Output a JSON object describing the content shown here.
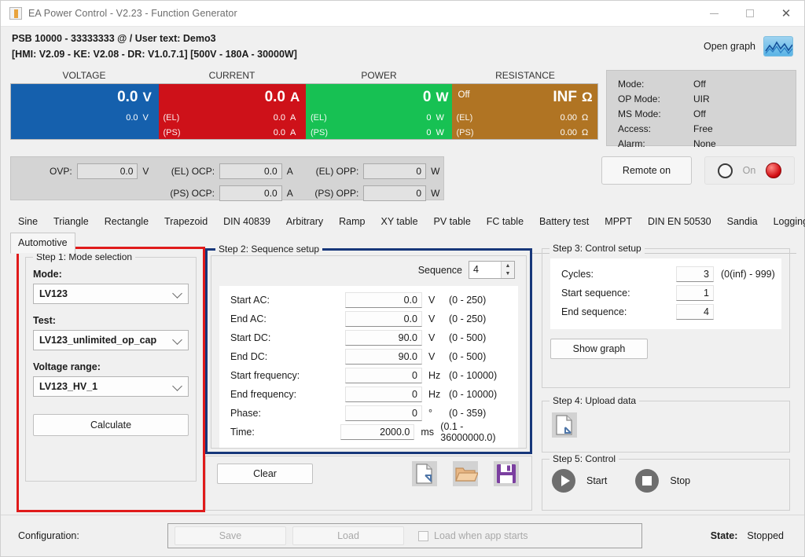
{
  "window": {
    "title": "EA Power Control - V2.23 - Function Generator",
    "app_icon": "app-icon",
    "minimize": "minimize-icon",
    "maximize": "maximize-icon",
    "close": "close-icon"
  },
  "header": {
    "line1": "PSB 10000 - 33333333 @ / User text: Demo3",
    "line2": "[HMI: V2.09 - KE: V2.08 - DR: V1.0.7.1] [500V - 180A - 30000W]",
    "open_graph_label": "Open graph",
    "open_graph_icon": "graph-icon"
  },
  "measurements": {
    "headers": [
      "VOLTAGE",
      "CURRENT",
      "POWER",
      "RESISTANCE"
    ],
    "colors": {
      "voltage": "#1560ad",
      "current": "#ce1119",
      "power": "#17c153",
      "resistance": "#b07423"
    },
    "voltage": {
      "main_value": "0.0",
      "main_unit": "V",
      "row2_tag": "",
      "row2_value": "0.0",
      "row2_unit": "V",
      "row3_tag": "",
      "row3_value": "",
      "row3_unit": ""
    },
    "current": {
      "main_value": "0.0",
      "main_unit": "A",
      "row2_tag": "(EL)",
      "row2_value": "0.0",
      "row2_unit": "A",
      "row3_tag": "(PS)",
      "row3_value": "0.0",
      "row3_unit": "A"
    },
    "power": {
      "main_value": "0",
      "main_unit": "W",
      "row2_tag": "(EL)",
      "row2_value": "0",
      "row2_unit": "W",
      "row3_tag": "(PS)",
      "row3_value": "0",
      "row3_unit": "W"
    },
    "resistance": {
      "off_label": "Off",
      "main_value": "INF",
      "main_unit": "Ω",
      "row2_tag": "(EL)",
      "row2_value": "0.00",
      "row2_unit": "Ω",
      "row3_tag": "(PS)",
      "row3_value": "0.00",
      "row3_unit": "Ω"
    }
  },
  "status": {
    "rows": [
      {
        "key": "Mode:",
        "value": "Off"
      },
      {
        "key": "OP Mode:",
        "value": "UIR"
      },
      {
        "key": "MS Mode:",
        "value": "Off"
      },
      {
        "key": "Access:",
        "value": "Free"
      },
      {
        "key": "Alarm:",
        "value": "None"
      }
    ]
  },
  "protections": {
    "ovp": {
      "label": "OVP:",
      "value": "0.0",
      "unit": "V"
    },
    "el_ocp": {
      "label": "(EL) OCP:",
      "value": "0.0",
      "unit": "A"
    },
    "ps_ocp": {
      "label": "(PS) OCP:",
      "value": "0.0",
      "unit": "A"
    },
    "el_opp": {
      "label": "(EL) OPP:",
      "value": "0",
      "unit": "W"
    },
    "ps_opp": {
      "label": "(PS) OPP:",
      "value": "0",
      "unit": "W"
    }
  },
  "remote": {
    "button_label": "Remote on",
    "on_label": "On",
    "led_color": "#d30f14"
  },
  "tabs": {
    "row1": [
      "Sine",
      "Triangle",
      "Rectangle",
      "Trapezoid",
      "DIN 40839",
      "Arbitrary",
      "Ramp",
      "XY table",
      "PV table",
      "FC table",
      "Battery test",
      "MPPT",
      "DIN EN 50530",
      "Sandia",
      "Logging"
    ],
    "row2": [
      "Automotive"
    ],
    "active": "Automotive"
  },
  "step1": {
    "legend": "Step 1: Mode selection",
    "mode_label": "Mode:",
    "mode_value": "LV123",
    "test_label": "Test:",
    "test_value": "LV123_unlimited_op_cap",
    "voltage_range_label": "Voltage range:",
    "voltage_range_value": "LV123_HV_1",
    "calculate_label": "Calculate",
    "border_color": "#e01b1b"
  },
  "step2": {
    "legend": "Step 2: Sequence setup",
    "sequence_label": "Sequence",
    "sequence_value": "4",
    "border_color": "#17377a",
    "fields": [
      {
        "name": "Start AC:",
        "value": "0.0",
        "unit": "V",
        "range": "(0 - 250)"
      },
      {
        "name": "End AC:",
        "value": "0.0",
        "unit": "V",
        "range": "(0 - 250)"
      },
      {
        "name": "Start DC:",
        "value": "90.0",
        "unit": "V",
        "range": "(0 - 500)"
      },
      {
        "name": "End DC:",
        "value": "90.0",
        "unit": "V",
        "range": "(0 - 500)"
      },
      {
        "name": "Start frequency:",
        "value": "0",
        "unit": "Hz",
        "range": "(0 - 10000)"
      },
      {
        "name": "End frequency:",
        "value": "0",
        "unit": "Hz",
        "range": "(0 - 10000)"
      },
      {
        "name": "Phase:",
        "value": "0",
        "unit": "°",
        "range": "(0 - 359)"
      },
      {
        "name": "Time:",
        "value": "2000.0",
        "unit": "ms",
        "range": "(0.1 - 36000000.0)"
      }
    ],
    "clear_label": "Clear",
    "file_icons": [
      "new-file-icon",
      "open-folder-icon",
      "save-disk-icon"
    ]
  },
  "step3": {
    "legend": "Step 3: Control setup",
    "fields": [
      {
        "name": "Cycles:",
        "value": "3",
        "range": "(0(inf) - 999)"
      },
      {
        "name": "Start sequence:",
        "value": "1",
        "range": ""
      },
      {
        "name": "End sequence:",
        "value": "4",
        "range": ""
      }
    ],
    "show_graph_label": "Show graph"
  },
  "step4": {
    "legend": "Step 4: Upload data",
    "upload_icon": "upload-file-icon"
  },
  "step5": {
    "legend": "Step 5: Control",
    "start_label": "Start",
    "stop_label": "Stop",
    "start_icon": "play-icon",
    "stop_icon": "stop-icon"
  },
  "bottom": {
    "configuration_label": "Configuration:",
    "save_label": "Save",
    "load_label": "Load",
    "load_on_start_label": "Load when app starts",
    "state_label": "State:",
    "state_value": "Stopped"
  }
}
